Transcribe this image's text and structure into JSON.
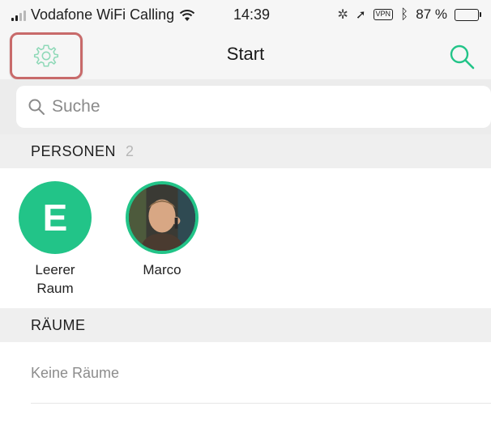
{
  "status_bar": {
    "carrier": "Vodafone WiFi Calling",
    "time": "14:39",
    "vpn": "VPN",
    "battery_percent": "87 %",
    "battery_level": 0.87
  },
  "nav": {
    "title": "Start",
    "settings_icon": "gear-icon",
    "search_icon": "search-icon"
  },
  "search": {
    "placeholder": "Suche",
    "value": ""
  },
  "people_section": {
    "title": "PERSONEN",
    "count": "2",
    "people": [
      {
        "initial": "E",
        "name_line1": "Leerer",
        "name_line2": "Raum"
      },
      {
        "name_line1": "Marco"
      }
    ]
  },
  "rooms_section": {
    "title": "RÄUME",
    "empty_text": "Keine Räume"
  },
  "colors": {
    "accent": "#22c488",
    "highlight": "#c86a6a"
  }
}
